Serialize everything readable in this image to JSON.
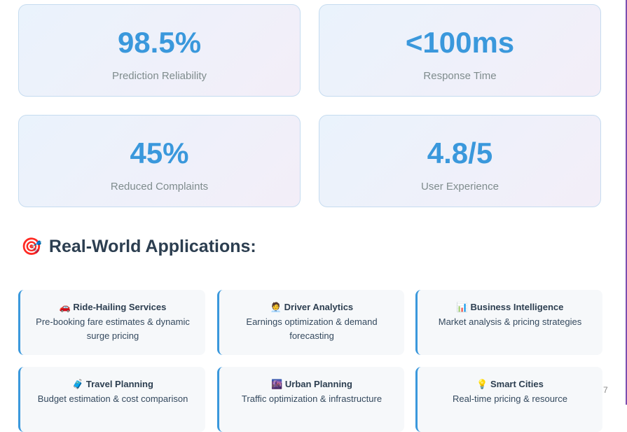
{
  "stats": [
    {
      "value": "98.5%",
      "label": "Prediction Reliability"
    },
    {
      "value": "<100ms",
      "label": "Response Time"
    },
    {
      "value": "45%",
      "label": "Reduced Complaints"
    },
    {
      "value": "4.8/5",
      "label": "User Experience"
    }
  ],
  "applications_section": {
    "icon": "🎯",
    "title": "Real-World Applications:"
  },
  "applications": [
    {
      "icon": "🚗",
      "title": "Ride-Hailing Services",
      "desc": "Pre-booking fare estimates & dynamic surge pricing"
    },
    {
      "icon": "🧑‍💼",
      "title": "Driver Analytics",
      "desc": "Earnings optimization & demand forecasting"
    },
    {
      "icon": "📊",
      "title": "Business Intelligence",
      "desc": "Market analysis & pricing strategies"
    },
    {
      "icon": "🧳",
      "title": "Travel Planning",
      "desc": "Budget estimation & cost comparison"
    },
    {
      "icon": "🌆",
      "title": "Urban Planning",
      "desc": "Traffic optimization & infrastructure"
    },
    {
      "icon": "💡",
      "title": "Smart Cities",
      "desc": "Real-time pricing & resource"
    }
  ],
  "page_number": "7",
  "colors": {
    "accent": "#3a98dc",
    "heading": "#2c3e50",
    "muted": "#7f8c8d"
  }
}
